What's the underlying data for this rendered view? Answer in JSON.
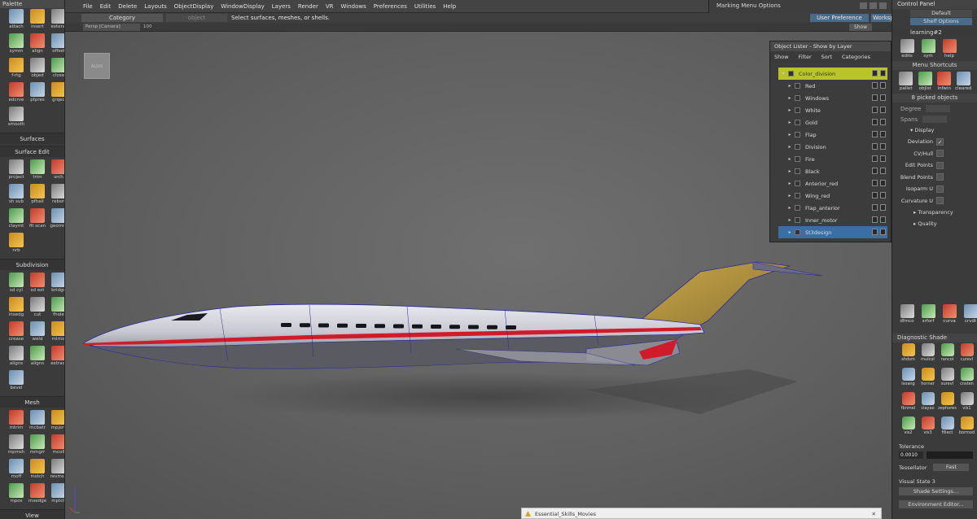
{
  "palette": {
    "title": "Palette",
    "sections": [
      {
        "title": "",
        "tools": [
          "attach",
          "insert",
          "extend",
          "symm",
          "align",
          "offset",
          "f-rtg",
          "objed",
          "close",
          "edcrve",
          "ptpres",
          "grqed",
          "smooth"
        ]
      },
      {
        "title": "Surfaces",
        "tools": []
      },
      {
        "title": "Surface Edit",
        "tools": [
          "project",
          "trim",
          "srch",
          "sh sub",
          "pfhall",
          "rebsrf",
          "claymt",
          "fit scan",
          "geomm",
          "nrb"
        ]
      },
      {
        "title": "Subdivision",
        "tools": [
          "sd cyl",
          "sd ext",
          "bridge",
          "insedg",
          "cut",
          "fhole",
          "crease",
          "weld",
          "mirror",
          "aligns",
          "aligns",
          "extract",
          "bevel"
        ]
      },
      {
        "title": "Mesh",
        "tools": [
          "mtrim",
          "mcbatr",
          "mpjsrv",
          "mpmsh",
          "mmgrr",
          "mcoll",
          "moff",
          "mstch",
          "revmsh",
          "mpos",
          "mxedge",
          "mptch"
        ]
      },
      {
        "title": "View",
        "tools": []
      }
    ]
  },
  "menubar": [
    "File",
    "Edit",
    "Delete",
    "Layouts",
    "ObjectDisplay",
    "WindowDisplay",
    "Layers",
    "Render",
    "VR",
    "Windows",
    "Preferences",
    "Utilities",
    "Help"
  ],
  "marking_menu": "Marking Menu Options",
  "toolbar": {
    "category": "Category",
    "object": "object",
    "prompt": "Select surfaces, meshes, or shells.",
    "user_pref": "User Preference Sets",
    "workspaces": "Workspaces"
  },
  "viewport": {
    "camera": "Persp [Camera]",
    "zoom": "100",
    "show_btn": "Show"
  },
  "object_lister": {
    "title": "Object Lister - Show by Layer",
    "menu": [
      "Show",
      "Filter",
      "Sort",
      "Categories"
    ],
    "rows": [
      "Color_division",
      "Red",
      "Windows",
      "White",
      "Gold",
      "Flap",
      "Division",
      "Fire",
      "Black",
      "Anterior_red",
      "Wing_red",
      "Flap_anterior",
      "Inner_motor",
      "St3design"
    ]
  },
  "control_panel": {
    "title": "Control Panel",
    "default": "Default",
    "shelf_options": "Shelf Options",
    "shelf_name": "learning#2",
    "shelf_tools": [
      "edits",
      "sym",
      "help"
    ],
    "menu_shortcuts": "Menu Shortcuts",
    "shortcut_tools": [
      "pallet",
      "objlst",
      "infwin",
      "cleared"
    ],
    "picked": "8 picked objects",
    "degree": "Degree",
    "spans": "Spans",
    "display": "Display",
    "options": [
      "Deviation",
      "CV/Hull",
      "Edit Points",
      "Blend Points",
      "Isoparm U",
      "Curvature U"
    ],
    "transparency": "Transparency",
    "quality": "Quality",
    "tool_row": [
      "dfmco",
      "srforf",
      "curva",
      "crvdt"
    ],
    "diagnostic": "Diagnostic Shade",
    "diag_tools": [
      "shdsm",
      "mulcol",
      "rancol",
      "curevl",
      "isoang",
      "horner",
      "surevl",
      "cnsten",
      "fbnmel",
      "clayao",
      "zephores",
      "vis1",
      "vis2",
      "vis3",
      "fillect",
      "bormod"
    ],
    "tolerance": "Tolerance",
    "tolerance_value": "0.0010",
    "tessellator": "Tessellator",
    "tess_value": "Fast",
    "visual_state": "Visual State 3",
    "shade_settings": "Shade Settings...",
    "env_editor": "Environment Editor..."
  },
  "taskbar": {
    "label": "Essential_Skills_Movies"
  },
  "colors": {
    "accent_lister": "#b8c42a",
    "select": "#3a6ea5",
    "stripe_red": "#d01c2a",
    "tail_gold": "#b8953a"
  }
}
